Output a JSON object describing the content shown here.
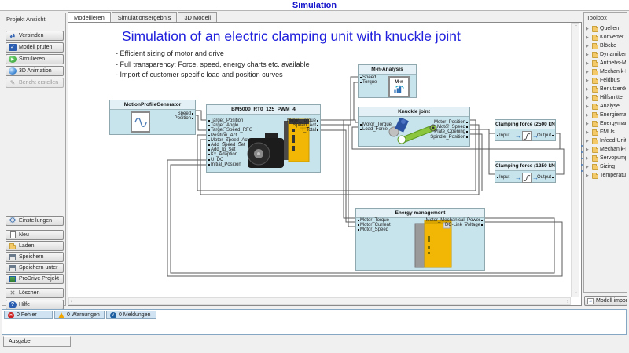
{
  "window": {
    "title": "Simulation"
  },
  "project_panel": {
    "title": "Projekt Ansicht",
    "buttons": {
      "verbinden": "Verbinden",
      "modell_pruefen": "Modell prüfen",
      "simulieren": "Simulieren",
      "animation_3d": "3D Animation",
      "bericht_erstellen": "Bericht erstellen",
      "einstellungen": "Einstellungen",
      "neu": "Neu",
      "laden": "Laden",
      "speichern": "Speichern",
      "speichern_unter": "Speichern unter",
      "prodrive_projekt": "ProDrive Projekt",
      "loeschen": "Löschen",
      "hilfe": "Hilfe"
    }
  },
  "tabs": {
    "modellieren": "Modellieren",
    "simulationsergebnis": "Simulationsergebnis",
    "modell_3d": "3D Modell",
    "active": "Modellieren"
  },
  "canvas": {
    "headline": "Simulation of an electric clamping unit with knuckle joint",
    "bullets": [
      "- Efficient sizing of motor and drive",
      "- Full transparency: Force, speed, energy charts etc. available",
      "- Import of customer specific load and position curves"
    ],
    "blocks": {
      "motion_profile_generator": {
        "title": "MotionProfileGenerator",
        "outputs": [
          "Speed",
          "Position"
        ]
      },
      "bm5000": {
        "title": "BM5000_RT0_125_PWM_4",
        "inputs": [
          "Target_Position",
          "Target_Angle",
          "Target_Speed_RFG",
          "Position_Act",
          "Motor_Speed_Act",
          "Add_Speed_Set",
          "Add_Iq_Set",
          "Kx_Adaption",
          "U_DC",
          "Initial_Position"
        ],
        "outputs": [
          "Motor_Torque",
          "Speed_Act",
          "I_Total"
        ]
      },
      "mn_analysis": {
        "title": "M-n-Analysis",
        "inputs": [
          "Speed",
          "Torque"
        ],
        "icon_label": "M-n"
      },
      "knuckle_joint": {
        "title": "Knuckle joint",
        "inputs": [
          "Motor_Torque",
          "Load_Force"
        ],
        "outputs": [
          "Motor_Position",
          "Motor_Speed",
          "Plate_Opening",
          "Spindle_Position"
        ]
      },
      "clamping_force_2500": {
        "title": "Clamping force (2500 kN)",
        "inputs": [
          "Input"
        ],
        "outputs": [
          "Output"
        ]
      },
      "clamping_force_1250": {
        "title": "Clamping force (1250 kN)",
        "inputs": [
          "Input"
        ],
        "outputs": [
          "Output"
        ]
      },
      "energy_management": {
        "title": "Energy management",
        "inputs": [
          "Motor_Torque",
          "Motor_Current",
          "Motor_Speed"
        ],
        "outputs": [
          "Motor_Mechanical_Power",
          "DC-Link_Voltage"
        ]
      }
    }
  },
  "toolbox": {
    "title": "Toolbox",
    "items": [
      "Quellen",
      "Konverter",
      "Blöcke",
      "Dynamiken",
      "Antriebs-Mod",
      "Mechanik-Mo",
      "Feldbus",
      "Benutzerdefin",
      "Hilfsmittel",
      "Analyse",
      "Energiemana",
      "Energymanag",
      "FMUs",
      "Infeed Units",
      "Mechanik-M",
      "Servopumpe",
      "Sizing",
      "TemperatureM"
    ],
    "import_button": "Modell importieren"
  },
  "status_bar": {
    "errors": "0 Fehler",
    "warnings": "0 Warnungen",
    "messages": "0 Meldungen",
    "output_tab": "Ausgabe"
  },
  "colors": {
    "accent_blue": "#2121dd",
    "block_fill": "#c7e3ec",
    "block_header": "#e3f1f6",
    "status_button": "#cfe3f3"
  }
}
